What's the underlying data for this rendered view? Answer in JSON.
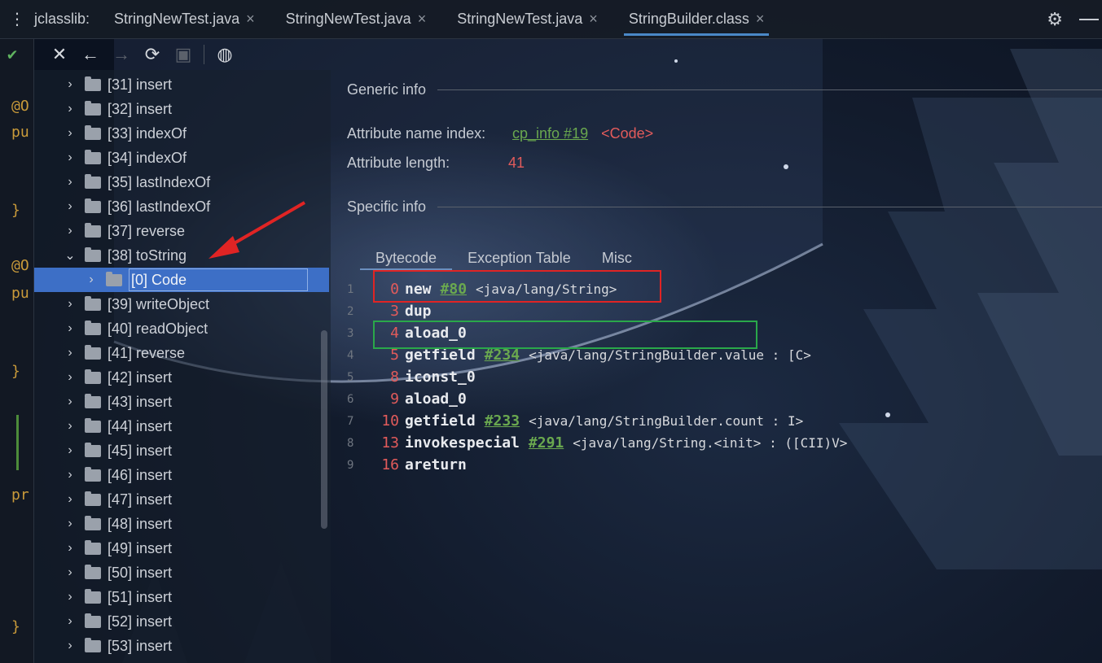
{
  "tabbar": {
    "tool_label": "jclasslib:",
    "tabs": [
      {
        "label": "StringNewTest.java",
        "close": "×"
      },
      {
        "label": "StringNewTest.java",
        "close": "×"
      },
      {
        "label": "StringNewTest.java",
        "close": "×"
      },
      {
        "label": "StringBuilder.class",
        "close": "×",
        "active": true
      }
    ],
    "kebab_icon": "⋮",
    "gear_icon": "⚙"
  },
  "gutter": {
    "fragments": [
      "@O",
      "pu",
      "}",
      "@O",
      "pu",
      "}",
      "pr",
      "}"
    ]
  },
  "toolbar": {
    "close_icon": "✕",
    "back_icon": "←",
    "forward_icon": "→",
    "refresh_icon": "⟳",
    "save_icon": "▣",
    "web_icon": "◍"
  },
  "tree": {
    "items": [
      {
        "label": "[31] insert",
        "expanded": false
      },
      {
        "label": "[32] insert",
        "expanded": false
      },
      {
        "label": "[33] indexOf",
        "expanded": false
      },
      {
        "label": "[34] indexOf",
        "expanded": false
      },
      {
        "label": "[35] lastIndexOf",
        "expanded": false
      },
      {
        "label": "[36] lastIndexOf",
        "expanded": false
      },
      {
        "label": "[37] reverse",
        "expanded": false
      },
      {
        "label": "[38] toString",
        "expanded": true
      },
      {
        "label": "[0] Code",
        "child": true,
        "selected": true
      },
      {
        "label": "[39] writeObject",
        "expanded": false
      },
      {
        "label": "[40] readObject",
        "expanded": false
      },
      {
        "label": "[41] reverse",
        "expanded": false
      },
      {
        "label": "[42] insert",
        "expanded": false
      },
      {
        "label": "[43] insert",
        "expanded": false
      },
      {
        "label": "[44] insert",
        "expanded": false
      },
      {
        "label": "[45] insert",
        "expanded": false
      },
      {
        "label": "[46] insert",
        "expanded": false
      },
      {
        "label": "[47] insert",
        "expanded": false
      },
      {
        "label": "[48] insert",
        "expanded": false
      },
      {
        "label": "[49] insert",
        "expanded": false
      },
      {
        "label": "[50] insert",
        "expanded": false
      },
      {
        "label": "[51] insert",
        "expanded": false
      },
      {
        "label": "[52] insert",
        "expanded": false
      },
      {
        "label": "[53] insert",
        "expanded": false
      }
    ]
  },
  "details": {
    "generic_info": "Generic info",
    "attr_name_index_label": "Attribute name index:",
    "attr_name_index_link": "cp_info #19",
    "attr_name_index_value": "<Code>",
    "attr_length_label": "Attribute length:",
    "attr_length_value": "41",
    "specific_info": "Specific info",
    "subtabs": [
      "Bytecode",
      "Exception Table",
      "Misc"
    ],
    "bytecode": [
      {
        "line": "1",
        "offset": "0",
        "op": "new",
        "ref": "#80",
        "comment": "<java/lang/String>"
      },
      {
        "line": "2",
        "offset": "3",
        "op": "dup",
        "ref": "",
        "comment": ""
      },
      {
        "line": "3",
        "offset": "4",
        "op": "aload_0",
        "ref": "",
        "comment": ""
      },
      {
        "line": "4",
        "offset": "5",
        "op": "getfield",
        "ref": "#234",
        "comment": "<java/lang/StringBuilder.value : [C>"
      },
      {
        "line": "5",
        "offset": "8",
        "op": "iconst_0",
        "ref": "",
        "comment": ""
      },
      {
        "line": "6",
        "offset": "9",
        "op": "aload_0",
        "ref": "",
        "comment": ""
      },
      {
        "line": "7",
        "offset": "10",
        "op": "getfield",
        "ref": "#233",
        "comment": "<java/lang/StringBuilder.count : I>"
      },
      {
        "line": "8",
        "offset": "13",
        "op": "invokespecial",
        "ref": "#291",
        "comment": "<java/lang/String.<init> : ([CII)V>"
      },
      {
        "line": "9",
        "offset": "16",
        "op": "areturn",
        "ref": "",
        "comment": ""
      }
    ]
  },
  "colors": {
    "accent": "#4a88c7",
    "selection": "#3d6fc6",
    "link_green": "#6aa84f",
    "offset_red": "#e25b5b",
    "annotation_red": "#e02424",
    "annotation_green": "#2aa84a"
  }
}
